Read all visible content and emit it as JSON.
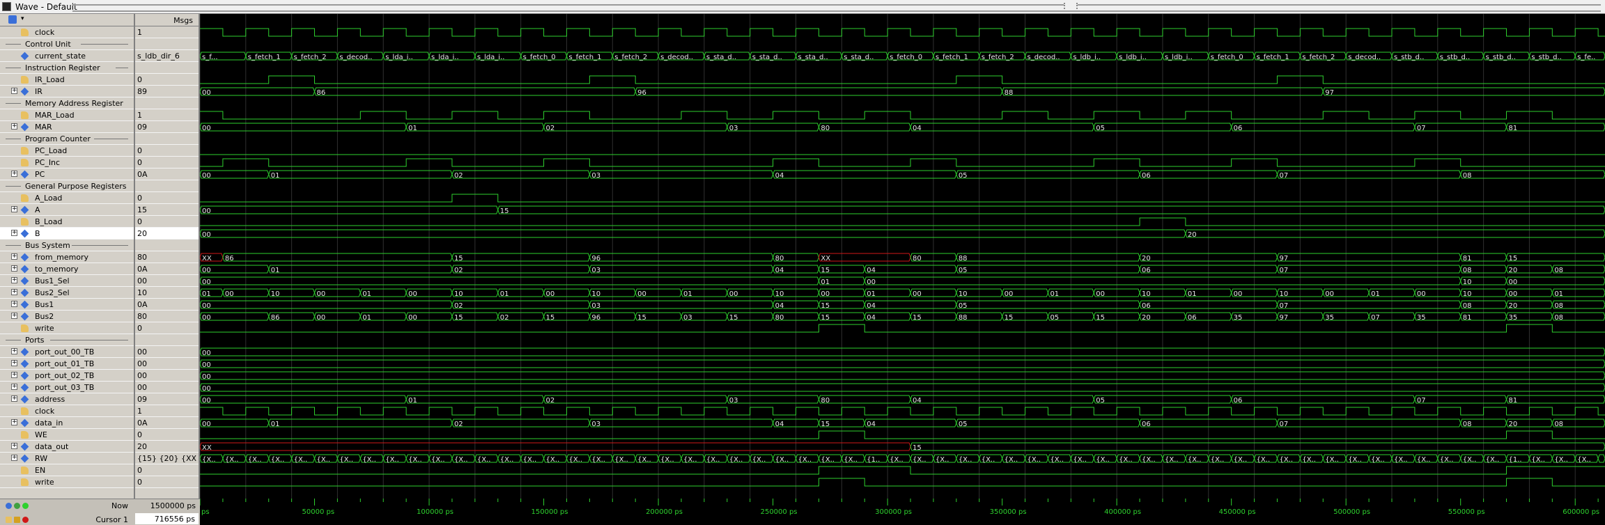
{
  "window": {
    "title": "Wave - Default"
  },
  "header": {
    "msgs_label": "Msgs"
  },
  "colors": {
    "wave": "#2ed12e",
    "cursor": "#f2f2f2",
    "invalid": "#d01818",
    "grid": "#6a6a6a",
    "time_axis": "#2ed12e",
    "selected_row_bg": "#ffffff"
  },
  "rows": [
    {
      "type": "signal",
      "kind": "bit",
      "name": "clock",
      "value": "1",
      "expandable": false,
      "indent": 1
    },
    {
      "type": "divider",
      "name": "Control Unit"
    },
    {
      "type": "signal",
      "kind": "bus",
      "name": "current_state",
      "value": "s_ldb_dir_6",
      "expandable": false,
      "indent": 1
    },
    {
      "type": "divider",
      "name": "Instruction Register"
    },
    {
      "type": "signal",
      "kind": "bit",
      "name": "IR_Load",
      "value": "0",
      "expandable": false,
      "indent": 1
    },
    {
      "type": "signal",
      "kind": "bus",
      "name": "IR",
      "value": "89",
      "expandable": true,
      "indent": 1
    },
    {
      "type": "divider",
      "name": "Memory Address Register"
    },
    {
      "type": "signal",
      "kind": "bit",
      "name": "MAR_Load",
      "value": "1",
      "expandable": false,
      "indent": 1
    },
    {
      "type": "signal",
      "kind": "bus",
      "name": "MAR",
      "value": "09",
      "expandable": true,
      "indent": 1
    },
    {
      "type": "divider",
      "name": "Program Counter"
    },
    {
      "type": "signal",
      "kind": "bit",
      "name": "PC_Load",
      "value": "0",
      "expandable": false,
      "indent": 1
    },
    {
      "type": "signal",
      "kind": "bit",
      "name": "PC_Inc",
      "value": "0",
      "expandable": false,
      "indent": 1
    },
    {
      "type": "signal",
      "kind": "bus",
      "name": "PC",
      "value": "0A",
      "expandable": true,
      "indent": 1
    },
    {
      "type": "divider",
      "name": "General Purpose Registers"
    },
    {
      "type": "signal",
      "kind": "bit",
      "name": "A_Load",
      "value": "0",
      "expandable": false,
      "indent": 1
    },
    {
      "type": "signal",
      "kind": "bus",
      "name": "A",
      "value": "15",
      "expandable": true,
      "indent": 1
    },
    {
      "type": "signal",
      "kind": "bit",
      "name": "B_Load",
      "value": "0",
      "expandable": false,
      "indent": 1
    },
    {
      "type": "signal",
      "kind": "bus",
      "name": "B",
      "value": "20",
      "expandable": true,
      "indent": 1,
      "selected": true
    },
    {
      "type": "divider",
      "name": "Bus System"
    },
    {
      "type": "signal",
      "kind": "bus",
      "name": "from_memory",
      "value": "80",
      "expandable": true,
      "indent": 1
    },
    {
      "type": "signal",
      "kind": "bus",
      "name": "to_memory",
      "value": "0A",
      "expandable": true,
      "indent": 1
    },
    {
      "type": "signal",
      "kind": "bus",
      "name": "Bus1_Sel",
      "value": "00",
      "expandable": true,
      "indent": 1
    },
    {
      "type": "signal",
      "kind": "bus",
      "name": "Bus2_Sel",
      "value": "10",
      "expandable": true,
      "indent": 1
    },
    {
      "type": "signal",
      "kind": "bus",
      "name": "Bus1",
      "value": "0A",
      "expandable": true,
      "indent": 1
    },
    {
      "type": "signal",
      "kind": "bus",
      "name": "Bus2",
      "value": "80",
      "expandable": true,
      "indent": 1
    },
    {
      "type": "signal",
      "kind": "bit",
      "name": "write",
      "value": "0",
      "expandable": false,
      "indent": 1
    },
    {
      "type": "divider",
      "name": "Ports"
    },
    {
      "type": "signal",
      "kind": "bus",
      "name": "port_out_00_TB",
      "value": "00",
      "expandable": true,
      "indent": 1
    },
    {
      "type": "signal",
      "kind": "bus",
      "name": "port_out_01_TB",
      "value": "00",
      "expandable": true,
      "indent": 1
    },
    {
      "type": "signal",
      "kind": "bus",
      "name": "port_out_02_TB",
      "value": "00",
      "expandable": true,
      "indent": 1
    },
    {
      "type": "signal",
      "kind": "bus",
      "name": "port_out_03_TB",
      "value": "00",
      "expandable": true,
      "indent": 1
    },
    {
      "type": "signal",
      "kind": "bus",
      "name": "address",
      "value": "09",
      "expandable": true,
      "indent": 1
    },
    {
      "type": "signal",
      "kind": "bit",
      "name": "clock",
      "value": "1",
      "expandable": false,
      "indent": 1
    },
    {
      "type": "signal",
      "kind": "bus",
      "name": "data_in",
      "value": "0A",
      "expandable": true,
      "indent": 1
    },
    {
      "type": "signal",
      "kind": "bit",
      "name": "WE",
      "value": "0",
      "expandable": false,
      "indent": 1
    },
    {
      "type": "signal",
      "kind": "bus",
      "name": "data_out",
      "value": "20",
      "expandable": true,
      "indent": 1
    },
    {
      "type": "signal",
      "kind": "bus",
      "name": "RW",
      "value": "{15} {20} {XX...",
      "expandable": true,
      "indent": 1
    },
    {
      "type": "signal",
      "kind": "bit",
      "name": "EN",
      "value": "0",
      "expandable": false,
      "indent": 1
    },
    {
      "type": "signal",
      "kind": "bit",
      "name": "write",
      "value": "0",
      "expandable": false,
      "indent": 1
    }
  ],
  "footer": {
    "now_label": "Now",
    "now_value": "1500000 ps",
    "cursor_label": "Cursor 1",
    "cursor_value": "716556 ps"
  },
  "time_axis": {
    "start": 0,
    "end": 613000,
    "unit": "ps",
    "labels": [
      "ps",
      "50000 ps",
      "100000 ps",
      "150000 ps",
      "200000 ps",
      "250000 ps",
      "300000 ps",
      "350000 ps",
      "400000 ps",
      "450000 ps",
      "500000 ps",
      "550000 ps",
      "600000 ps"
    ]
  },
  "waves": {
    "clock": {
      "period": 20000,
      "offset": 0
    },
    "current_state": [
      "s_f...",
      "s_fetch_1",
      "s_fetch_2",
      "s_decode_3",
      "s_lda_imm_4",
      "s_lda_imm_5",
      "s_lda_imm_6",
      "s_fetch_0",
      "s_fetch_1",
      "s_fetch_2",
      "s_decode_3",
      "s_sta_dir_4",
      "s_sta_dir_5",
      "s_sta_dir_6",
      "s_sta_dir_7",
      "s_fetch_0",
      "s_fetch_1",
      "s_fetch_2",
      "s_decode_3",
      "s_ldb_imm_4",
      "s_ldb_imm_5",
      "s_ldb_imm_6",
      "s_fetch_0",
      "s_fetch_1",
      "s_fetch_2",
      "s_decode_3",
      "s_stb_dir_4",
      "s_stb_dir_5",
      "s_stb_dir_6",
      "s_stb_dir_7",
      "s_fetch_0"
    ],
    "IR_Load": [
      [
        0,
        0
      ],
      [
        30000,
        1
      ],
      [
        50000,
        0
      ],
      [
        170000,
        1
      ],
      [
        190000,
        0
      ],
      [
        330000,
        1
      ],
      [
        350000,
        0
      ],
      [
        470000,
        1
      ],
      [
        490000,
        0
      ]
    ],
    "IR": [
      [
        0,
        "00"
      ],
      [
        50000,
        "86"
      ],
      [
        190000,
        "96"
      ],
      [
        350000,
        "88"
      ],
      [
        490000,
        "97"
      ]
    ],
    "MAR_Load": [
      [
        0,
        1
      ],
      [
        10000,
        0
      ],
      [
        70000,
        1
      ],
      [
        90000,
        0
      ],
      [
        110000,
        1
      ],
      [
        130000,
        0
      ],
      [
        150000,
        1
      ],
      [
        170000,
        0
      ],
      [
        210000,
        1
      ],
      [
        230000,
        0
      ],
      [
        250000,
        1
      ],
      [
        270000,
        0
      ],
      [
        290000,
        1
      ],
      [
        310000,
        0
      ],
      [
        350000,
        1
      ],
      [
        370000,
        0
      ],
      [
        390000,
        1
      ],
      [
        410000,
        0
      ],
      [
        430000,
        1
      ],
      [
        450000,
        0
      ],
      [
        490000,
        1
      ],
      [
        510000,
        0
      ],
      [
        530000,
        1
      ],
      [
        550000,
        0
      ],
      [
        570000,
        1
      ],
      [
        590000,
        0
      ]
    ],
    "MAR": [
      [
        0,
        "00"
      ],
      [
        90000,
        "01"
      ],
      [
        150000,
        "02"
      ],
      [
        230000,
        "03"
      ],
      [
        270000,
        "80"
      ],
      [
        310000,
        "04"
      ],
      [
        390000,
        "05"
      ],
      [
        450000,
        "06"
      ],
      [
        530000,
        "07"
      ],
      [
        570000,
        "81"
      ]
    ],
    "PC_Load": [
      [
        0,
        0
      ]
    ],
    "PC_Inc": [
      [
        0,
        0
      ],
      [
        10000,
        1
      ],
      [
        30000,
        0
      ],
      [
        90000,
        1
      ],
      [
        110000,
        0
      ],
      [
        150000,
        1
      ],
      [
        170000,
        0
      ],
      [
        250000,
        1
      ],
      [
        270000,
        0
      ],
      [
        310000,
        1
      ],
      [
        330000,
        0
      ],
      [
        390000,
        1
      ],
      [
        410000,
        0
      ],
      [
        450000,
        1
      ],
      [
        470000,
        0
      ],
      [
        530000,
        1
      ],
      [
        550000,
        0
      ]
    ],
    "PC": [
      [
        0,
        "00"
      ],
      [
        30000,
        "01"
      ],
      [
        110000,
        "02"
      ],
      [
        170000,
        "03"
      ],
      [
        250000,
        "04"
      ],
      [
        330000,
        "05"
      ],
      [
        410000,
        "06"
      ],
      [
        470000,
        "07"
      ],
      [
        550000,
        "08"
      ]
    ],
    "A_Load": [
      [
        0,
        0
      ],
      [
        110000,
        1
      ],
      [
        130000,
        0
      ]
    ],
    "A": [
      [
        0,
        "00"
      ],
      [
        130000,
        "15"
      ]
    ],
    "B_Load": [
      [
        0,
        0
      ],
      [
        410000,
        1
      ],
      [
        430000,
        0
      ]
    ],
    "B": [
      [
        0,
        "00"
      ],
      [
        430000,
        "20"
      ]
    ],
    "from_memory": [
      [
        0,
        "XX"
      ],
      [
        10000,
        "86"
      ],
      [
        110000,
        "15"
      ],
      [
        170000,
        "96"
      ],
      [
        250000,
        "80"
      ],
      [
        270000,
        "XX"
      ],
      [
        310000,
        "80"
      ],
      [
        330000,
        "88"
      ],
      [
        410000,
        "20"
      ],
      [
        470000,
        "97"
      ],
      [
        550000,
        "81"
      ],
      [
        570000,
        "15"
      ]
    ],
    "to_memory": [
      [
        0,
        "00"
      ],
      [
        30000,
        "01"
      ],
      [
        110000,
        "02"
      ],
      [
        170000,
        "03"
      ],
      [
        250000,
        "04"
      ],
      [
        270000,
        "15"
      ],
      [
        290000,
        "04"
      ],
      [
        330000,
        "05"
      ],
      [
        410000,
        "06"
      ],
      [
        470000,
        "07"
      ],
      [
        550000,
        "08"
      ],
      [
        570000,
        "20"
      ],
      [
        590000,
        "08"
      ]
    ],
    "Bus1_Sel": [
      [
        0,
        "00"
      ],
      [
        270000,
        "01"
      ],
      [
        290000,
        "00"
      ],
      [
        550000,
        "10"
      ],
      [
        570000,
        "00"
      ]
    ],
    "Bus2_Sel": [
      [
        0,
        "01"
      ],
      [
        10000,
        "00"
      ],
      [
        30000,
        "10"
      ],
      [
        50000,
        "00"
      ],
      [
        70000,
        "01"
      ],
      [
        90000,
        "00"
      ],
      [
        110000,
        "10"
      ],
      [
        130000,
        "01"
      ],
      [
        150000,
        "00"
      ],
      [
        170000,
        "10"
      ],
      [
        190000,
        "00"
      ],
      [
        210000,
        "01"
      ],
      [
        230000,
        "00"
      ],
      [
        250000,
        "10"
      ],
      [
        270000,
        "00"
      ],
      [
        290000,
        "01"
      ],
      [
        310000,
        "00"
      ],
      [
        330000,
        "10"
      ],
      [
        350000,
        "00"
      ],
      [
        370000,
        "01"
      ],
      [
        390000,
        "00"
      ],
      [
        410000,
        "10"
      ],
      [
        430000,
        "01"
      ],
      [
        450000,
        "00"
      ],
      [
        470000,
        "10"
      ],
      [
        490000,
        "00"
      ],
      [
        510000,
        "01"
      ],
      [
        530000,
        "00"
      ],
      [
        550000,
        "10"
      ],
      [
        570000,
        "00"
      ],
      [
        590000,
        "01"
      ]
    ],
    "Bus1": [
      [
        0,
        "00"
      ],
      [
        110000,
        "02"
      ],
      [
        170000,
        "03"
      ],
      [
        250000,
        "04"
      ],
      [
        270000,
        "15"
      ],
      [
        290000,
        "04"
      ],
      [
        330000,
        "05"
      ],
      [
        410000,
        "06"
      ],
      [
        470000,
        "07"
      ],
      [
        550000,
        "08"
      ],
      [
        570000,
        "20"
      ],
      [
        590000,
        "08"
      ]
    ],
    "Bus2": [
      [
        0,
        "00"
      ],
      [
        30000,
        "86"
      ],
      [
        50000,
        "00"
      ],
      [
        70000,
        "01"
      ],
      [
        90000,
        "00"
      ],
      [
        110000,
        "15"
      ],
      [
        130000,
        "02"
      ],
      [
        150000,
        "15"
      ],
      [
        170000,
        "96"
      ],
      [
        190000,
        "15"
      ],
      [
        210000,
        "03"
      ],
      [
        230000,
        "15"
      ],
      [
        250000,
        "80"
      ],
      [
        270000,
        "15"
      ],
      [
        290000,
        "04"
      ],
      [
        310000,
        "15"
      ],
      [
        330000,
        "88"
      ],
      [
        350000,
        "15"
      ],
      [
        370000,
        "05"
      ],
      [
        390000,
        "15"
      ],
      [
        410000,
        "20"
      ],
      [
        430000,
        "06"
      ],
      [
        450000,
        "35"
      ],
      [
        470000,
        "97"
      ],
      [
        490000,
        "35"
      ],
      [
        510000,
        "07"
      ],
      [
        530000,
        "35"
      ],
      [
        550000,
        "81"
      ],
      [
        570000,
        "35"
      ],
      [
        590000,
        "08"
      ]
    ],
    "write": [
      [
        0,
        0
      ],
      [
        270000,
        1
      ],
      [
        290000,
        0
      ],
      [
        570000,
        1
      ],
      [
        590000,
        0
      ]
    ],
    "port_out_00_TB": [
      [
        0,
        "00"
      ]
    ],
    "port_out_01_TB": [
      [
        0,
        "00"
      ]
    ],
    "port_out_02_TB": [
      [
        0,
        "00"
      ]
    ],
    "port_out_03_TB": [
      [
        0,
        "00"
      ]
    ],
    "address": [
      [
        0,
        "00"
      ],
      [
        90000,
        "01"
      ],
      [
        150000,
        "02"
      ],
      [
        230000,
        "03"
      ],
      [
        270000,
        "80"
      ],
      [
        310000,
        "04"
      ],
      [
        390000,
        "05"
      ],
      [
        450000,
        "06"
      ],
      [
        530000,
        "07"
      ],
      [
        570000,
        "81"
      ]
    ],
    "data_in": [
      [
        0,
        "00"
      ],
      [
        30000,
        "01"
      ],
      [
        110000,
        "02"
      ],
      [
        170000,
        "03"
      ],
      [
        250000,
        "04"
      ],
      [
        270000,
        "15"
      ],
      [
        290000,
        "04"
      ],
      [
        330000,
        "05"
      ],
      [
        410000,
        "06"
      ],
      [
        470000,
        "07"
      ],
      [
        550000,
        "08"
      ],
      [
        570000,
        "20"
      ],
      [
        590000,
        "08"
      ]
    ],
    "WE": [
      [
        0,
        0
      ],
      [
        270000,
        1
      ],
      [
        290000,
        0
      ],
      [
        570000,
        1
      ],
      [
        590000,
        0
      ]
    ],
    "data_out": [
      [
        0,
        "XX"
      ],
      [
        310000,
        "15"
      ]
    ],
    "RW_pattern": "{XX} {XX}",
    "RW_special": [
      "{XX...",
      "{15} {XX} {XX} {XX...",
      "{15} {20} {XX..."
    ],
    "EN": [
      [
        0,
        0
      ],
      [
        270000,
        1
      ],
      [
        310000,
        0
      ],
      [
        570000,
        1
      ],
      [
        613000,
        1
      ]
    ]
  }
}
